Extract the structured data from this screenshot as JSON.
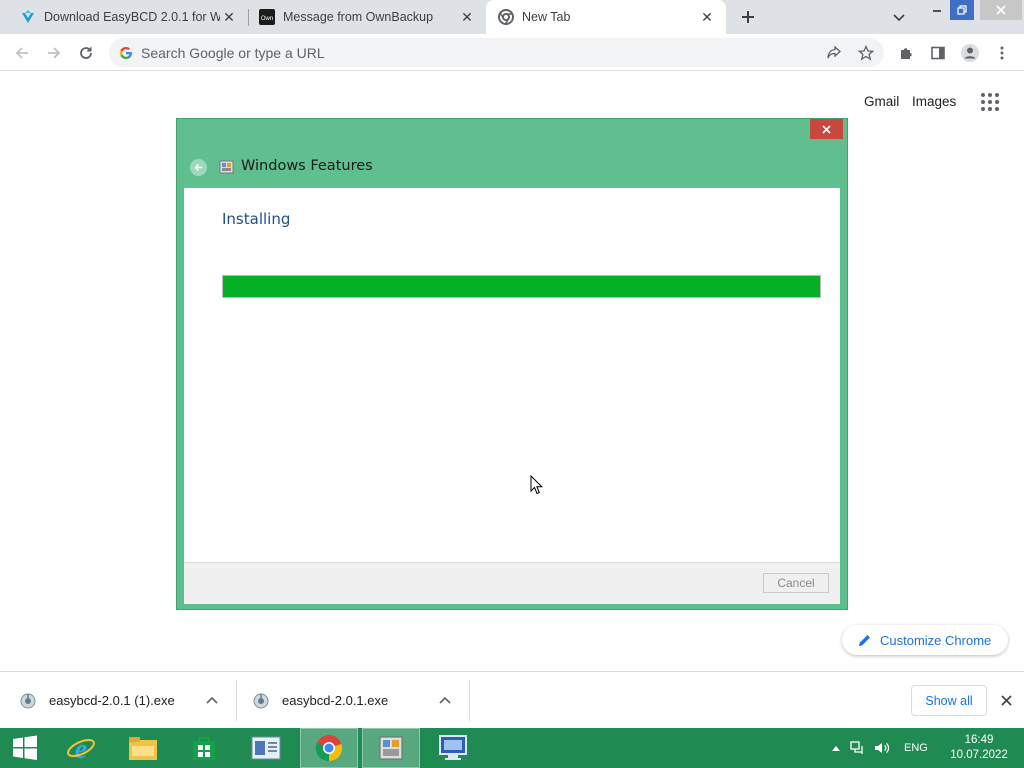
{
  "browser": {
    "tabs": [
      {
        "title": "Download EasyBCD 2.0.1 for Win",
        "favicon": "easybcd-icon",
        "active": false
      },
      {
        "title": "Message from OwnBackup",
        "favicon": "ownbackup-icon",
        "active": false
      },
      {
        "title": "New Tab",
        "favicon": "chrome-icon",
        "active": true
      }
    ],
    "omnibox_placeholder": "Search Google or type a URL"
  },
  "ntp": {
    "gmail_label": "Gmail",
    "images_label": "Images",
    "customize_label": "Customize Chrome"
  },
  "dialog": {
    "title": "Windows Features",
    "heading": "Installing",
    "progress": 1.0,
    "cancel_label": "Cancel",
    "colors": {
      "frame": "#5fbf8e",
      "progress": "#06b025",
      "close": "#c9483c"
    }
  },
  "downloads": {
    "items": [
      {
        "name": "easybcd-2.0.1 (1).exe"
      },
      {
        "name": "easybcd-2.0.1.exe"
      }
    ],
    "show_all_label": "Show all"
  },
  "taskbar": {
    "apps": [
      "start-icon",
      "internet-explorer-icon",
      "file-explorer-icon",
      "store-icon",
      "control-panel-icon",
      "chrome-icon",
      "windows-features-icon",
      "remote-desktop-icon"
    ],
    "language": "ENG",
    "time": "16:49",
    "date": "10.07.2022"
  }
}
